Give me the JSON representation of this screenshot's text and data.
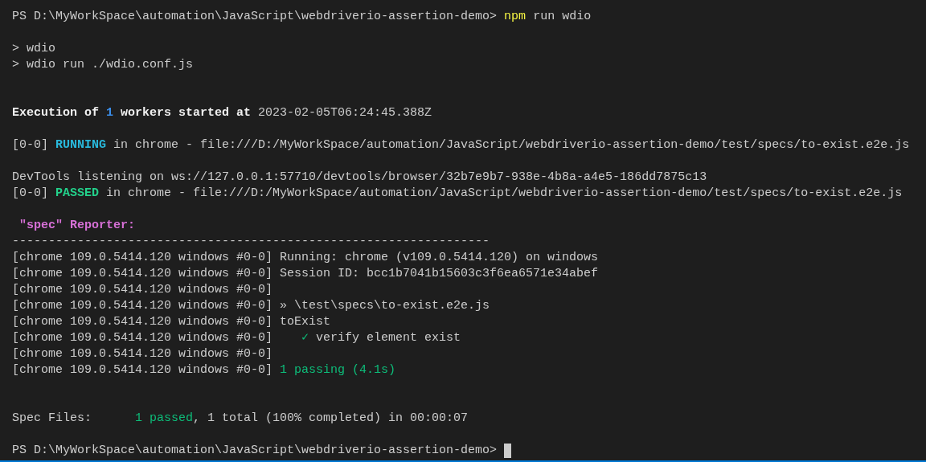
{
  "terminal": {
    "lines": [
      {
        "kind": "text",
        "segments": [
          {
            "text": "PS D:\\MyWorkSpace\\automation\\JavaScript\\webdriverio-assertion-demo> ",
            "kind": "plain"
          },
          {
            "text": "npm",
            "kind": "command"
          },
          {
            "text": " run wdio",
            "kind": "plain"
          }
        ]
      },
      {
        "kind": "blank"
      },
      {
        "kind": "text",
        "segments": [
          {
            "text": "> wdio",
            "kind": "plain"
          }
        ]
      },
      {
        "kind": "text",
        "segments": [
          {
            "text": "> wdio run ./wdio.conf.js",
            "kind": "plain"
          }
        ]
      },
      {
        "kind": "blank"
      },
      {
        "kind": "blank"
      },
      {
        "kind": "text",
        "segments": [
          {
            "text": "Execution of ",
            "kind": "bold"
          },
          {
            "text": "1",
            "kind": "count"
          },
          {
            "text": " workers started at ",
            "kind": "bold"
          },
          {
            "text": "2023-02-05T06:24:45.388Z",
            "kind": "plain"
          }
        ]
      },
      {
        "kind": "blank"
      },
      {
        "kind": "text",
        "segments": [
          {
            "text": "[0-0] ",
            "kind": "plain"
          },
          {
            "text": "RUNNING",
            "kind": "running"
          },
          {
            "text": " in chrome - file:///D:/MyWorkSpace/automation/JavaScript/webdriverio-assertion-demo/test/specs/to-exist.e2e.js",
            "kind": "plain"
          }
        ]
      },
      {
        "kind": "blank"
      },
      {
        "kind": "text",
        "segments": [
          {
            "text": "DevTools listening on ws://127.0.0.1:57710/devtools/browser/32b7e9b7-938e-4b8a-a4e5-186dd7875c13",
            "kind": "plain"
          }
        ]
      },
      {
        "kind": "text",
        "segments": [
          {
            "text": "[0-0] ",
            "kind": "plain"
          },
          {
            "text": "PASSED",
            "kind": "passed"
          },
          {
            "text": " in chrome - file:///D:/MyWorkSpace/automation/JavaScript/webdriverio-assertion-demo/test/specs/to-exist.e2e.js",
            "kind": "plain"
          }
        ]
      },
      {
        "kind": "blank"
      },
      {
        "kind": "text",
        "segments": [
          {
            "text": " \"spec\" Reporter:",
            "kind": "reporter"
          }
        ]
      },
      {
        "kind": "text",
        "segments": [
          {
            "text": "------------------------------------------------------------------",
            "kind": "plain"
          }
        ]
      },
      {
        "kind": "text",
        "segments": [
          {
            "text": "[chrome 109.0.5414.120 windows #0-0] Running: chrome (v109.0.5414.120) on windows",
            "kind": "plain"
          }
        ]
      },
      {
        "kind": "text",
        "segments": [
          {
            "text": "[chrome 109.0.5414.120 windows #0-0] Session ID: bcc1b7041b15603c3f6ea6571e34abef",
            "kind": "plain"
          }
        ]
      },
      {
        "kind": "text",
        "segments": [
          {
            "text": "[chrome 109.0.5414.120 windows #0-0]",
            "kind": "plain"
          }
        ]
      },
      {
        "kind": "text",
        "segments": [
          {
            "text": "[chrome 109.0.5414.120 windows #0-0] » \\test\\specs\\to-exist.e2e.js",
            "kind": "plain"
          }
        ]
      },
      {
        "kind": "text",
        "segments": [
          {
            "text": "[chrome 109.0.5414.120 windows #0-0] toExist",
            "kind": "plain"
          }
        ]
      },
      {
        "kind": "text",
        "segments": [
          {
            "text": "[chrome 109.0.5414.120 windows #0-0]    ",
            "kind": "plain"
          },
          {
            "text": "✓",
            "kind": "success"
          },
          {
            "text": " verify element exist",
            "kind": "plain"
          }
        ]
      },
      {
        "kind": "text",
        "segments": [
          {
            "text": "[chrome 109.0.5414.120 windows #0-0]",
            "kind": "plain"
          }
        ]
      },
      {
        "kind": "text",
        "segments": [
          {
            "text": "[chrome 109.0.5414.120 windows #0-0] ",
            "kind": "plain"
          },
          {
            "text": "1 passing (4.1s)",
            "kind": "success"
          }
        ]
      },
      {
        "kind": "blank"
      },
      {
        "kind": "blank"
      },
      {
        "kind": "text",
        "segments": [
          {
            "text": "Spec Files:      ",
            "kind": "plain"
          },
          {
            "text": "1 passed",
            "kind": "success"
          },
          {
            "text": ", 1 total (100% completed) in 00:00:07",
            "kind": "plain"
          }
        ]
      },
      {
        "kind": "blank"
      },
      {
        "kind": "text",
        "cursor": true,
        "segments": [
          {
            "text": "PS D:\\MyWorkSpace\\automation\\JavaScript\\webdriverio-assertion-demo> ",
            "kind": "plain"
          }
        ]
      }
    ]
  }
}
